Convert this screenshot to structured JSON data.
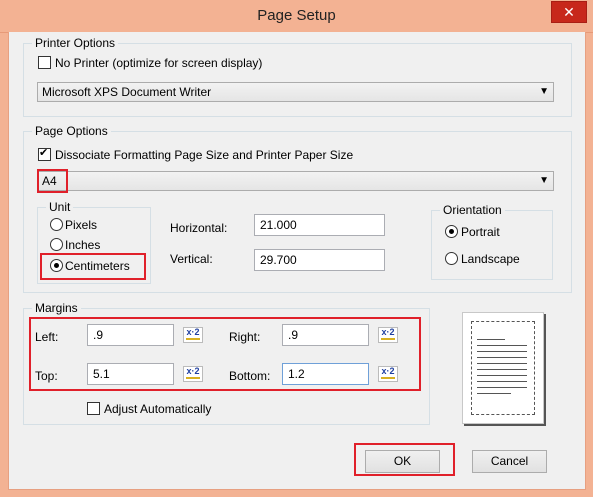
{
  "window": {
    "title": "Page Setup",
    "close_glyph": "✕"
  },
  "printer_options": {
    "legend": "Printer Options",
    "no_printer_label": "No Printer (optimize for screen display)",
    "no_printer_checked": false,
    "printer_selected": "Microsoft XPS Document Writer"
  },
  "page_options": {
    "legend": "Page Options",
    "dissociate_label": "Dissociate Formatting Page Size and Printer Paper Size",
    "dissociate_checked": true,
    "paper_size": "A4",
    "unit": {
      "legend": "Unit",
      "options": [
        "Pixels",
        "Inches",
        "Centimeters"
      ],
      "selected": "Centimeters"
    },
    "horizontal_label": "Horizontal:",
    "horizontal_value": "21.000",
    "vertical_label": "Vertical:",
    "vertical_value": "29.700",
    "orientation": {
      "legend": "Orientation",
      "options": [
        "Portrait",
        "Landscape"
      ],
      "selected": "Portrait"
    }
  },
  "margins": {
    "legend": "Margins",
    "left_label": "Left:",
    "left_value": ".9",
    "right_label": "Right:",
    "right_value": ".9",
    "top_label": "Top:",
    "top_value": "5.1",
    "bottom_label": "Bottom:",
    "bottom_value": "1.2",
    "calc_icon_text": "x·2",
    "adjust_label": "Adjust Automatically",
    "adjust_checked": false
  },
  "buttons": {
    "ok": "OK",
    "cancel": "Cancel"
  },
  "colors": {
    "title_bar": "#f3b293",
    "close": "#c7281b",
    "highlight": "#e0202a"
  }
}
